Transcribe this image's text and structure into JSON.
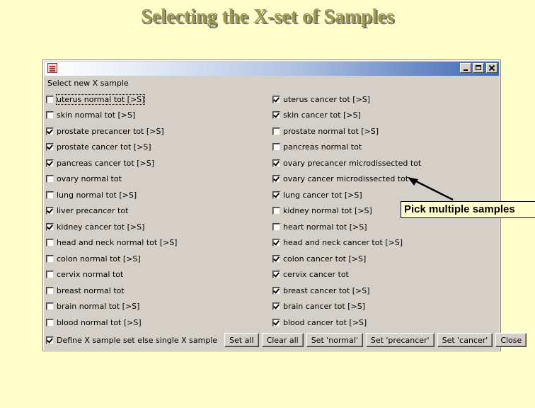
{
  "slide": {
    "title": "Selecting the X-set of Samples"
  },
  "window": {
    "prompt": "Select new X sample"
  },
  "checkboxes": {
    "left": [
      {
        "label": "uterus normal tot [>S]",
        "checked": false,
        "focused": true
      },
      {
        "label": "skin normal tot [>S]",
        "checked": false
      },
      {
        "label": "prostate precancer tot [>S]",
        "checked": true
      },
      {
        "label": "prostate cancer tot [>S]",
        "checked": true
      },
      {
        "label": "pancreas cancer tot [>S]",
        "checked": true
      },
      {
        "label": "ovary normal tot",
        "checked": false
      },
      {
        "label": "lung normal tot [>S]",
        "checked": false
      },
      {
        "label": "liver precancer tot",
        "checked": true
      },
      {
        "label": "kidney cancer tot [>S]",
        "checked": true
      },
      {
        "label": "head and neck normal tot [>S]",
        "checked": false
      },
      {
        "label": "colon normal tot [>S]",
        "checked": false
      },
      {
        "label": "cervix normal tot",
        "checked": false
      },
      {
        "label": "breast normal tot",
        "checked": false
      },
      {
        "label": "brain normal tot [>S]",
        "checked": false
      },
      {
        "label": "blood normal tot [>S]",
        "checked": false
      }
    ],
    "right": [
      {
        "label": "uterus cancer tot [>S]",
        "checked": true
      },
      {
        "label": "skin cancer tot [>S]",
        "checked": true
      },
      {
        "label": "prostate normal tot [>S]",
        "checked": false
      },
      {
        "label": "pancreas normal tot",
        "checked": false
      },
      {
        "label": "ovary precancer microdissected tot",
        "checked": true
      },
      {
        "label": "ovary cancer microdissected tot",
        "checked": true
      },
      {
        "label": "lung cancer tot [>S]",
        "checked": true
      },
      {
        "label": "kidney normal tot [>S]",
        "checked": false
      },
      {
        "label": "heart normal tot [>S]",
        "checked": false
      },
      {
        "label": "head and neck cancer tot [>S]",
        "checked": true
      },
      {
        "label": "colon cancer tot [>S]",
        "checked": true
      },
      {
        "label": "cervix cancer tot",
        "checked": true
      },
      {
        "label": "breast cancer tot [>S]",
        "checked": true
      },
      {
        "label": "brain cancer tot [>S]",
        "checked": true
      },
      {
        "label": "blood cancer tot [>S]",
        "checked": true
      }
    ]
  },
  "bottom": {
    "define_label": "Define X sample set else single X sample",
    "define_checked": true,
    "buttons": [
      "Set all",
      "Clear all",
      "Set 'normal'",
      "Set 'precancer'",
      "Set 'cancer'",
      "Close"
    ]
  },
  "callout": {
    "text": "Pick multiple samples"
  },
  "colors": {
    "background": "#ffffcc",
    "title": "#a09a50",
    "dialog": "#d4d0c8",
    "titlebar_end": "#3f68b4"
  },
  "icons": [
    "app-icon",
    "minimize-icon",
    "maximize-icon",
    "close-icon",
    "checkmark-icon"
  ]
}
